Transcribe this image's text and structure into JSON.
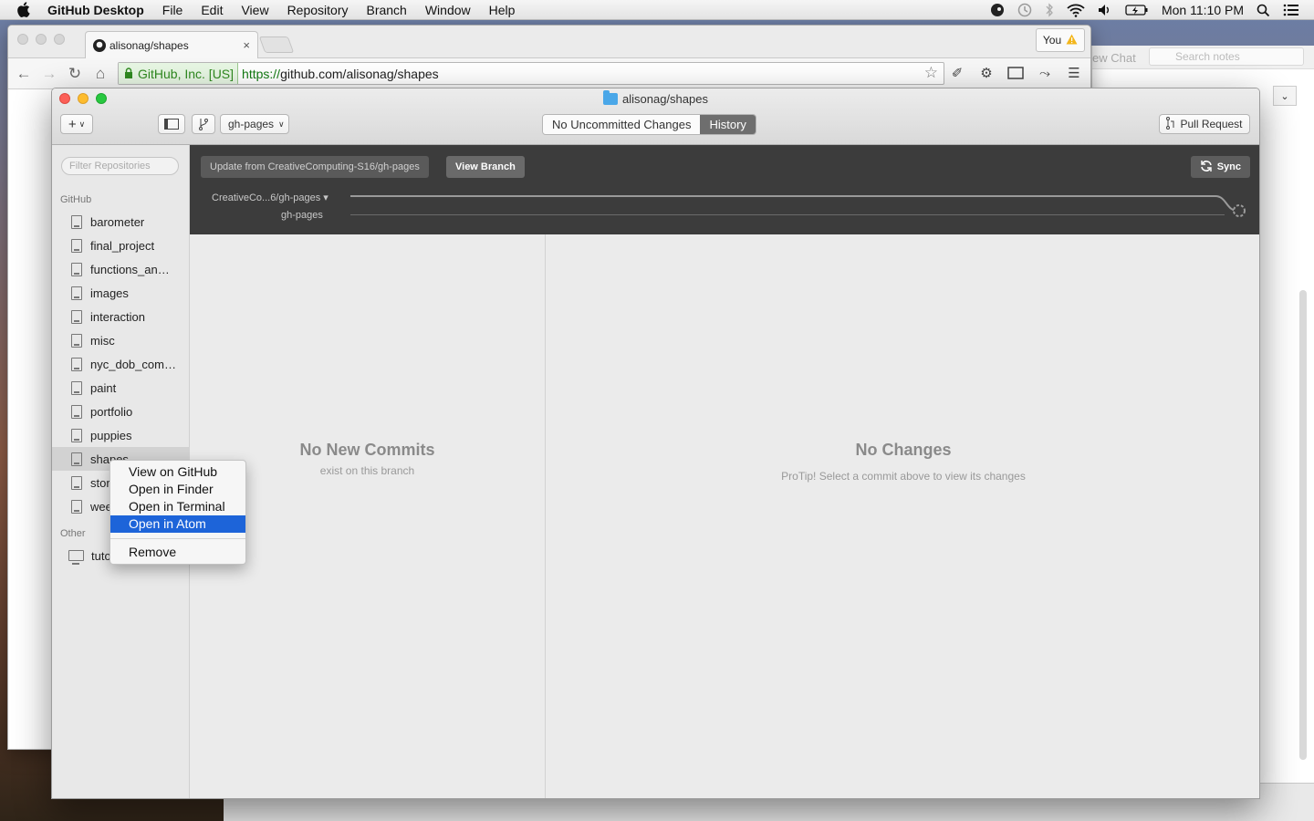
{
  "menubar": {
    "app_name": "GitHub Desktop",
    "items": [
      "File",
      "Edit",
      "View",
      "Repository",
      "Branch",
      "Window",
      "Help"
    ],
    "clock": "Mon 11:10 PM"
  },
  "browser": {
    "tab_title": "alisonag/shapes",
    "tab_close": "×",
    "profile_label": "You",
    "ev_label": "GitHub, Inc. [US]",
    "url_scheme": "https://",
    "url_rest": "github.com/alisonag/shapes"
  },
  "bg_app": {
    "chat_label": "ew Chat",
    "search_placeholder": "Search notes"
  },
  "desktop": {
    "window_title": "alisonag/shapes",
    "branch_selector": "gh-pages",
    "tabs": {
      "uncommitted": "No Uncommitted Changes",
      "history": "History"
    },
    "pull_request": "Pull Request",
    "filter_placeholder": "Filter Repositories",
    "sections": {
      "github": "GitHub",
      "other": "Other"
    },
    "repos": [
      "barometer",
      "final_project",
      "functions_an…",
      "images",
      "interaction",
      "misc",
      "nyc_dob_com…",
      "paint",
      "portfolio",
      "puppies",
      "shapes",
      "stor",
      "wee"
    ],
    "other_repos": [
      "tuto"
    ],
    "branch_bar": {
      "update_button": "Update from CreativeComputing-S16/gh-pages",
      "view_branch": "View Branch",
      "sync": "Sync",
      "compare_branch": "CreativeCo...6/gh-pages ▾",
      "current_branch": "gh-pages"
    },
    "commits_panel": {
      "title": "No New Commits",
      "subtitle": "exist on this branch"
    },
    "changes_panel": {
      "title": "No Changes",
      "subtitle": "ProTip! Select a commit above to view its changes"
    }
  },
  "context_menu": {
    "items": [
      "View on GitHub",
      "Open in Finder",
      "Open in Terminal",
      "Open in Atom"
    ],
    "highlighted": "Open in Atom",
    "remove": "Remove"
  },
  "colors": {
    "menu_highlight": "#1d64d9",
    "branch_bar_bg": "#3c3c3c"
  }
}
